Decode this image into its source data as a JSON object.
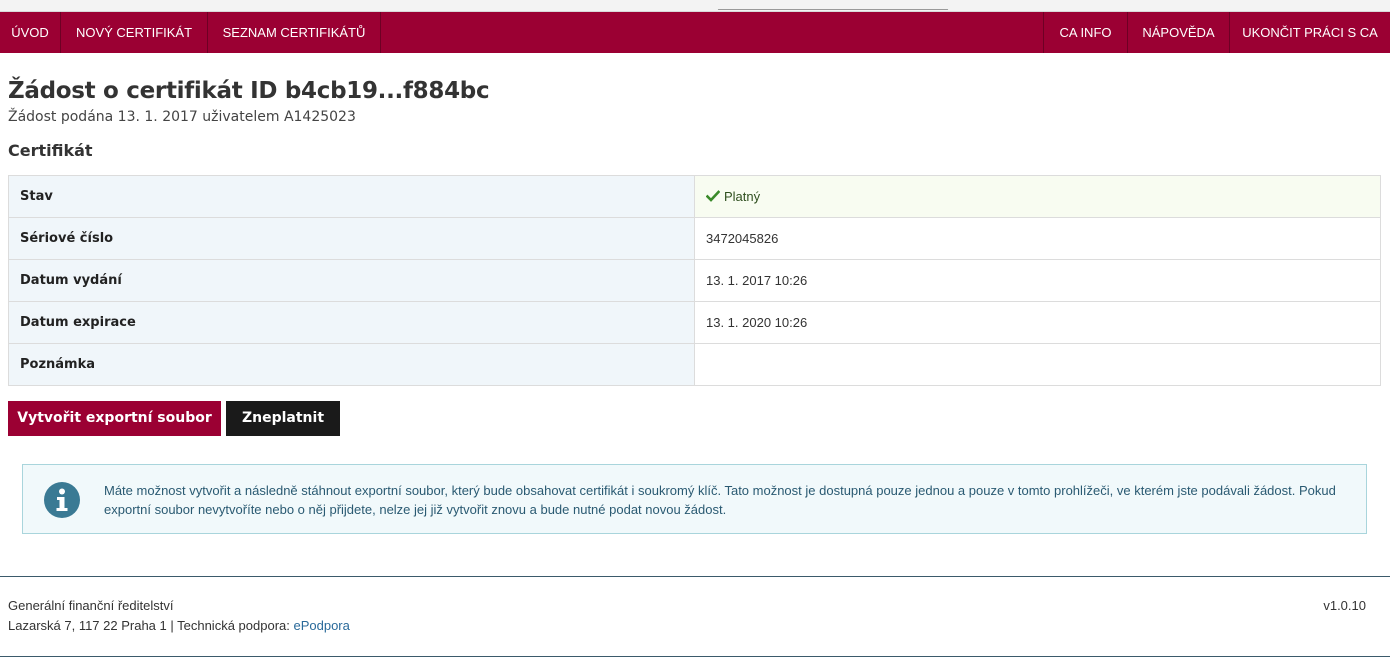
{
  "colors": {
    "brand": "#9b0033",
    "dark_button": "#1a1a1a",
    "label_bg": "#f0f6fa",
    "status_ok_bg": "#f8fcf1",
    "status_ok_icon": "#3a8a2a",
    "info_border": "#a9d5dc",
    "info_bg": "#f1f9fb",
    "info_icon": "#3a7a94",
    "link": "#2a6a9a"
  },
  "nav": {
    "left": [
      {
        "label": "Úvod"
      },
      {
        "label": "Nový certifikát"
      },
      {
        "label": "Seznam certifikátů"
      }
    ],
    "right": [
      {
        "label": "CA info"
      },
      {
        "label": "Nápověda"
      },
      {
        "label": "Ukončit práci s CA"
      }
    ]
  },
  "header": {
    "title": "Žádost o certifikát ID b4cb19...f884bc",
    "subtitle": "Žádost podána 13. 1. 2017 uživatelem A1425023"
  },
  "certificate": {
    "section_title": "Certifikát",
    "rows": [
      {
        "label": "Stav",
        "value": "Platný",
        "icon": "check-icon"
      },
      {
        "label": "Sériové číslo",
        "value": "3472045826"
      },
      {
        "label": "Datum vydání",
        "value": "13. 1. 2017 10:26"
      },
      {
        "label": "Datum expirace",
        "value": "13. 1. 2020 10:26"
      },
      {
        "label": "Poznámka",
        "value": ""
      }
    ]
  },
  "actions": {
    "export_label": "Vytvořit exportní soubor",
    "revoke_label": "Zneplatnit"
  },
  "info": {
    "icon": "info-icon",
    "text": "Máte možnost vytvořit a následně stáhnout exportní soubor, který bude obsahovat certifikát i soukromý klíč. Tato možnost je dostupná pouze jednou a pouze v tomto prohlížeči, ve kterém jste podávali žádost. Pokud exportní soubor nevytvoříte nebo o něj přijdete, nelze jej již vytvořit znovu a bude nutné podat novou žádost."
  },
  "footer": {
    "organization": "Generální finanční ředitelství",
    "address": "Lazarská 7, 117 22 Praha 1 | Technická podpora: ",
    "support_link": "ePodpora",
    "version": "v1.0.10"
  }
}
